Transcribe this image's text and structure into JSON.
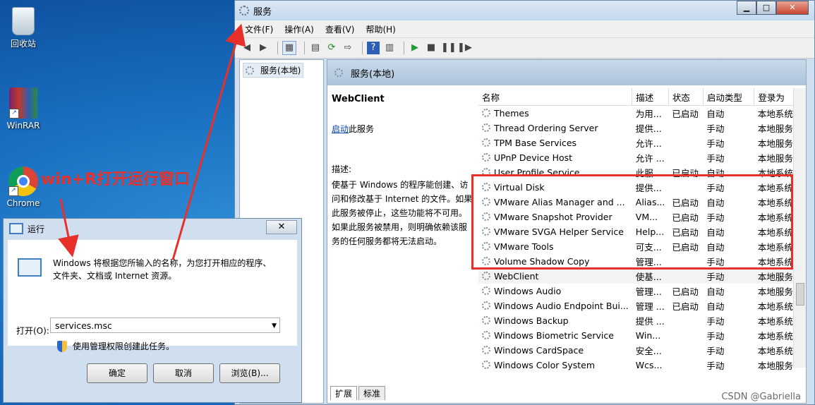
{
  "desktop": {
    "icons": [
      {
        "label": "回收站",
        "icon": "recycle-bin-icon"
      },
      {
        "label": "WinRAR",
        "icon": "winrar-icon"
      },
      {
        "label": "Chrome",
        "icon": "chrome-icon"
      }
    ]
  },
  "services_window": {
    "title": "服务",
    "controls": {
      "minimize": "▁",
      "maximize": "□",
      "close": "✕"
    },
    "menu": [
      "文件(F)",
      "操作(A)",
      "查看(V)",
      "帮助(H)"
    ],
    "tree_item": "服务(本地)",
    "header_title": "服务(本地)",
    "detail": {
      "service_name": "WebClient",
      "start_link": "启动",
      "start_suffix": "此服务",
      "desc_label": "描述:",
      "desc_text": "使基于 Windows 的程序能创建、访问和修改基于 Internet 的文件。如果此服务被停止，这些功能将不可用。如果此服务被禁用，则明确依赖该服务的任何服务都将无法启动。"
    },
    "columns": [
      "名称",
      "描述",
      "状态",
      "启动类型",
      "登录为"
    ],
    "rows": [
      [
        "Themes",
        "为用...",
        "已启动",
        "自动",
        "本地系统"
      ],
      [
        "Thread Ordering Server",
        "提供...",
        "",
        "手动",
        "本地服务"
      ],
      [
        "TPM Base Services",
        "允许...",
        "",
        "手动",
        "本地服务"
      ],
      [
        "UPnP Device Host",
        "允许 ...",
        "",
        "手动",
        "本地服务"
      ],
      [
        "User Profile Service",
        "此服...",
        "已启动",
        "自动",
        "本地系统"
      ],
      [
        "Virtual Disk",
        "提供...",
        "",
        "手动",
        "本地系统"
      ],
      [
        "VMware Alias Manager and ...",
        "Alias...",
        "已启动",
        "自动",
        "本地系统"
      ],
      [
        "VMware Snapshot Provider",
        "VM...",
        "已启动",
        "手动",
        "本地系统"
      ],
      [
        "VMware SVGA Helper Service",
        "Help...",
        "已启动",
        "自动",
        "本地系统"
      ],
      [
        "VMware Tools",
        "可支...",
        "已启动",
        "自动",
        "本地系统"
      ],
      [
        "Volume Shadow Copy",
        "管理...",
        "",
        "手动",
        "本地系统"
      ],
      [
        "WebClient",
        "使基...",
        "",
        "手动",
        "本地服务"
      ],
      [
        "Windows Audio",
        "管理...",
        "已启动",
        "自动",
        "本地服务"
      ],
      [
        "Windows Audio Endpoint Bui...",
        "管理 ...",
        "已启动",
        "自动",
        "本地系统"
      ],
      [
        "Windows Backup",
        "提供 ...",
        "",
        "手动",
        "本地系统"
      ],
      [
        "Windows Biometric Service",
        "Win...",
        "",
        "手动",
        "本地系统"
      ],
      [
        "Windows CardSpace",
        "安全...",
        "",
        "手动",
        "本地系统"
      ],
      [
        "Windows Color System",
        "Wcs...",
        "",
        "手动",
        "本地服务"
      ]
    ],
    "tabs": [
      "扩展",
      "标准"
    ]
  },
  "run_dialog": {
    "title": "运行",
    "close": "✕",
    "message": "Windows 将根据您所输入的名称，为您打开相应的程序、文件夹、文档或 Internet 资源。",
    "open_label": "打开(O):",
    "input_value": "services.msc",
    "admin_note": "使用管理权限创建此任务。",
    "buttons": {
      "ok": "确定",
      "cancel": "取消",
      "browse": "浏览(B)..."
    }
  },
  "annotation": {
    "text": "win+R打开运行窗口",
    "color": "#e8302a"
  },
  "watermark": "CSDN @Gabriella"
}
